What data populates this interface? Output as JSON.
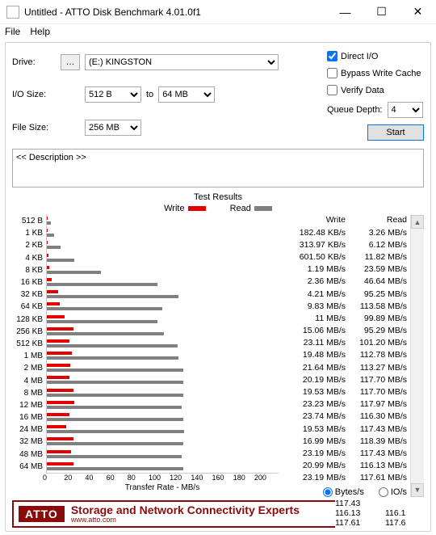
{
  "window": {
    "title": "Untitled - ATTO Disk Benchmark 4.01.0f1"
  },
  "menu": {
    "file": "File",
    "help": "Help"
  },
  "labels": {
    "drive": "Drive:",
    "io_size": "I/O Size:",
    "to": "to",
    "file_size": "File Size:",
    "direct_io": "Direct I/O",
    "bypass": "Bypass Write Cache",
    "verify": "Verify Data",
    "queue_depth": "Queue Depth:",
    "start": "Start",
    "description": "<< Description >>",
    "test_results": "Test Results",
    "write": "Write",
    "read": "Read",
    "transfer_rate": "Transfer Rate - MB/s",
    "bytes_s": "Bytes/s",
    "io_s": "IO/s"
  },
  "form": {
    "drive": "(E:) KINGSTON",
    "io_from": "512 B",
    "io_to": "64 MB",
    "file_size": "256 MB",
    "direct_io_checked": true,
    "bypass_checked": false,
    "verify_checked": false,
    "queue_depth": "4",
    "unit_selected": "bytes"
  },
  "banner": {
    "logo": "ATTO",
    "line1": "Storage and Network Connectivity Experts",
    "sub": "www.atto.com"
  },
  "chart_data": {
    "type": "bar",
    "title": "Test Results",
    "xlabel": "Transfer Rate - MB/s",
    "xlim": [
      0,
      200
    ],
    "xticks": [
      0,
      20,
      40,
      60,
      80,
      100,
      120,
      140,
      160,
      180,
      200
    ],
    "categories": [
      "512 B",
      "1 KB",
      "2 KB",
      "4 KB",
      "8 KB",
      "16 KB",
      "32 KB",
      "64 KB",
      "128 KB",
      "256 KB",
      "512 KB",
      "1 MB",
      "2 MB",
      "4 MB",
      "8 MB",
      "12 MB",
      "16 MB",
      "24 MB",
      "32 MB",
      "48 MB",
      "64 MB"
    ],
    "series": [
      {
        "name": "Write",
        "values_mb_s": [
          0.178,
          0.307,
          0.587,
          1.19,
          2.36,
          4.21,
          9.83,
          11,
          15.06,
          23.11,
          19.48,
          21.64,
          20.19,
          19.53,
          23.23,
          23.74,
          19.53,
          16.99,
          23.19,
          20.99,
          23.19
        ]
      },
      {
        "name": "Read",
        "values_mb_s": [
          3.26,
          6.12,
          11.82,
          23.59,
          46.64,
          95.25,
          113.58,
          99.89,
          95.29,
          101.2,
          112.78,
          113.27,
          117.7,
          117.7,
          117.97,
          116.3,
          117.43,
          118.39,
          117.43,
          116.13,
          117.61
        ]
      }
    ]
  },
  "results": [
    {
      "label": "512 B",
      "write": "182.48 KB/s",
      "read": "3.26 MB/s"
    },
    {
      "label": "1 KB",
      "write": "313.97 KB/s",
      "read": "6.12 MB/s"
    },
    {
      "label": "2 KB",
      "write": "601.50 KB/s",
      "read": "11.82 MB/s"
    },
    {
      "label": "4 KB",
      "write": "1.19 MB/s",
      "read": "23.59 MB/s"
    },
    {
      "label": "8 KB",
      "write": "2.36 MB/s",
      "read": "46.64 MB/s"
    },
    {
      "label": "16 KB",
      "write": "4.21 MB/s",
      "read": "95.25 MB/s"
    },
    {
      "label": "32 KB",
      "write": "9.83 MB/s",
      "read": "113.58 MB/s"
    },
    {
      "label": "64 KB",
      "write": "11 MB/s",
      "read": "99.89 MB/s"
    },
    {
      "label": "128 KB",
      "write": "15.06 MB/s",
      "read": "95.29 MB/s"
    },
    {
      "label": "256 KB",
      "write": "23.11 MB/s",
      "read": "101.20 MB/s"
    },
    {
      "label": "512 KB",
      "write": "19.48 MB/s",
      "read": "112.78 MB/s"
    },
    {
      "label": "1 MB",
      "write": "21.64 MB/s",
      "read": "113.27 MB/s"
    },
    {
      "label": "2 MB",
      "write": "20.19 MB/s",
      "read": "117.70 MB/s"
    },
    {
      "label": "4 MB",
      "write": "19.53 MB/s",
      "read": "117.70 MB/s"
    },
    {
      "label": "8 MB",
      "write": "23.23 MB/s",
      "read": "117.97 MB/s"
    },
    {
      "label": "12 MB",
      "write": "23.74 MB/s",
      "read": "116.30 MB/s"
    },
    {
      "label": "16 MB",
      "write": "19.53 MB/s",
      "read": "117.43 MB/s"
    },
    {
      "label": "24 MB",
      "write": "16.99 MB/s",
      "read": "118.39 MB/s"
    },
    {
      "label": "32 MB",
      "write": "23.19 MB/s",
      "read": "117.43 MB/s"
    },
    {
      "label": "48 MB",
      "write": "20.99 MB/s",
      "read": "116.13 MB/s"
    },
    {
      "label": "64 MB",
      "write": "23.19 MB/s",
      "read": "117.61 MB/s"
    }
  ],
  "overflow": [
    {
      "w": "117.43",
      "r": ""
    },
    {
      "w": "116.13",
      "r": "116.1"
    },
    {
      "w": "117.61",
      "r": "117.6"
    }
  ]
}
